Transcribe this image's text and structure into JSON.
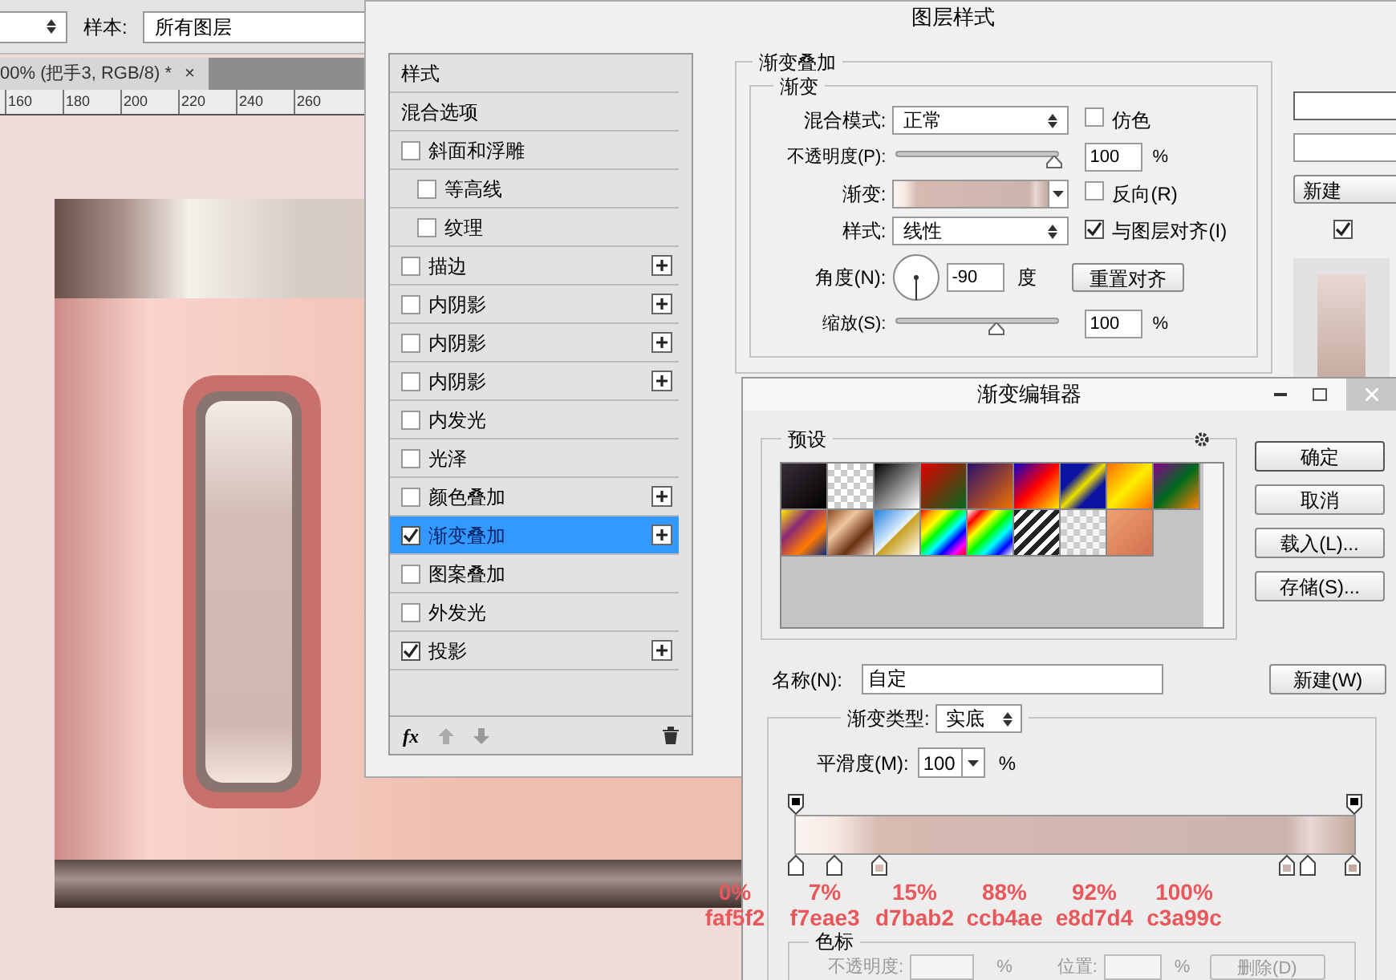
{
  "toolbar": {
    "sample_label": "样本:",
    "sample_value": "所有图层"
  },
  "document_tab": {
    "title": "00% (把手3, RGB/8) *",
    "close": "×"
  },
  "ruler": [
    "160",
    "180",
    "200",
    "220",
    "240",
    "260"
  ],
  "layer_style": {
    "title": "图层样式",
    "styles": [
      {
        "label": "样式",
        "kind": "header"
      },
      {
        "label": "混合选项",
        "kind": "header"
      },
      {
        "label": "斜面和浮雕",
        "kind": "option",
        "checked": false,
        "selected": false,
        "add": false,
        "children": [
          {
            "label": "等高线",
            "checked": false
          },
          {
            "label": "纹理",
            "checked": false
          }
        ]
      },
      {
        "label": "描边",
        "kind": "option",
        "checked": false,
        "selected": false,
        "add": true
      },
      {
        "label": "内阴影",
        "kind": "option",
        "checked": false,
        "selected": false,
        "add": true
      },
      {
        "label": "内阴影",
        "kind": "option",
        "checked": false,
        "selected": false,
        "add": true
      },
      {
        "label": "内阴影",
        "kind": "option",
        "checked": false,
        "selected": false,
        "add": true
      },
      {
        "label": "内发光",
        "kind": "option",
        "checked": false,
        "selected": false,
        "add": false
      },
      {
        "label": "光泽",
        "kind": "option",
        "checked": false,
        "selected": false,
        "add": false
      },
      {
        "label": "颜色叠加",
        "kind": "option",
        "checked": false,
        "selected": false,
        "add": true
      },
      {
        "label": "渐变叠加",
        "kind": "option",
        "checked": true,
        "selected": true,
        "add": true
      },
      {
        "label": "图案叠加",
        "kind": "option",
        "checked": false,
        "selected": false,
        "add": false
      },
      {
        "label": "外发光",
        "kind": "option",
        "checked": false,
        "selected": false,
        "add": false
      },
      {
        "label": "投影",
        "kind": "option",
        "checked": true,
        "selected": false,
        "add": true
      }
    ],
    "section": "渐变叠加",
    "group": "渐变",
    "blend_mode": {
      "label": "混合模式:",
      "value": "正常"
    },
    "dither": {
      "label": "仿色",
      "checked": false
    },
    "opacity": {
      "label": "不透明度(P):",
      "level": 1,
      "value": "100",
      "unit": "%"
    },
    "gradient": {
      "label": "渐变:"
    },
    "reverse": {
      "label": "反向(R)",
      "checked": false
    },
    "style": {
      "label": "样式:",
      "value": "线性"
    },
    "align": {
      "label": "与图层对齐(I)",
      "checked": true
    },
    "angle": {
      "label": "角度(N):",
      "value": "-90",
      "unit": "度"
    },
    "reset_button": "重置对齐",
    "scale": {
      "label": "缩放(S):",
      "level": 0.62,
      "value": "100",
      "unit": "%"
    },
    "new_style_button": "新建",
    "preview": {
      "checked": true
    },
    "fx_button": "fx"
  },
  "gradient_editor": {
    "title": "渐变编辑器",
    "presets_label": "预设",
    "buttons": [
      "确定",
      "取消",
      "载入(L)...",
      "存储(S)..."
    ],
    "name": {
      "label": "名称(N):",
      "value": "自定"
    },
    "new_button": "新建(W)",
    "type": {
      "label": "渐变类型:",
      "value": "实底"
    },
    "smoothness": {
      "label": "平滑度(M):",
      "value": "100",
      "unit": "%"
    },
    "color_stops": {
      "label": "色标",
      "opacity_label": "不透明度:",
      "opacity_unit": "%",
      "position_label": "位置:",
      "position_unit": "%",
      "delete_button": "删除(D)",
      "disabled": true
    }
  },
  "annotations": [
    {
      "percent": "0%",
      "hex": "faf5f2"
    },
    {
      "percent": "7%",
      "hex": "f7eae3"
    },
    {
      "percent": "15%",
      "hex": "d7bab2"
    },
    {
      "percent": "88%",
      "hex": "ccb4ae"
    },
    {
      "percent": "92%",
      "hex": "e8d7d4"
    },
    {
      "percent": "100%",
      "hex": "c3a99c"
    }
  ]
}
